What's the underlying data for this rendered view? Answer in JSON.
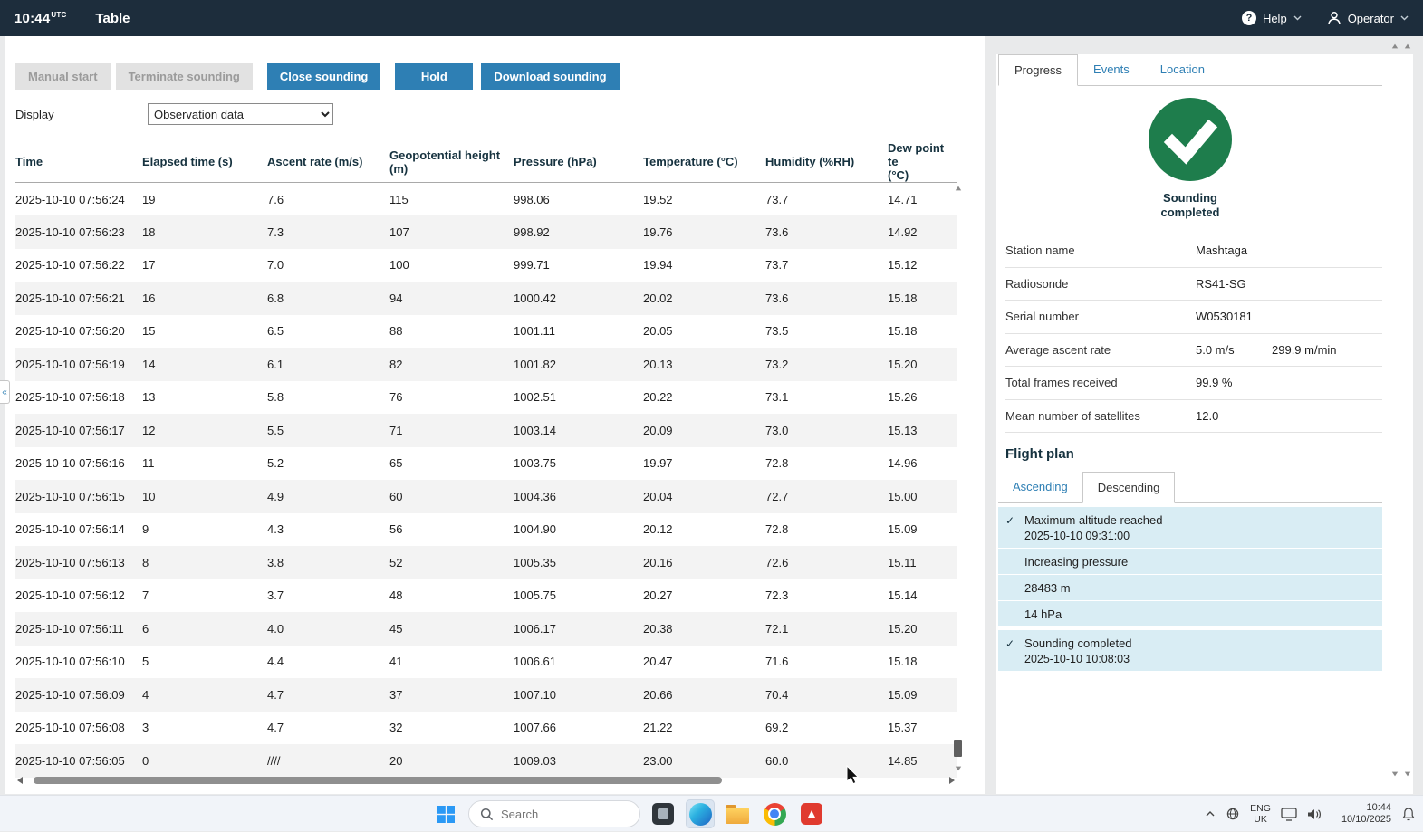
{
  "colors": {
    "topbar_bg": "#1d2d3c",
    "accent": "#2e7fb4",
    "success": "#1e7d4c",
    "event_bg": "#d9edf4",
    "stripe": "#f3f3f3",
    "disabled_bg": "#e2e2e2",
    "disabled_text": "#9b9b9b",
    "navy_text": "#16323f",
    "page_bg": "#e9eaeb",
    "taskbar_bg": "#f1f4f9"
  },
  "topbar": {
    "time": "10:44",
    "time_suffix": "UTC",
    "title": "Table",
    "help_label": "Help",
    "operator_label": "Operator"
  },
  "toolbar": {
    "buttons": [
      {
        "label": "Manual start",
        "state": "disabled"
      },
      {
        "label": "Terminate sounding",
        "state": "disabled"
      },
      {
        "label": "Close sounding",
        "state": "primary"
      },
      {
        "label": "Hold",
        "state": "primary"
      },
      {
        "label": "Download sounding",
        "state": "primary"
      }
    ],
    "display_label": "Display",
    "display_value": "Observation data"
  },
  "table": {
    "columns": [
      "Time",
      "Elapsed time (s)",
      "Ascent rate (m/s)",
      "Geopotential height\n(m)",
      "Pressure (hPa)",
      "Temperature (°C)",
      "Humidity (%RH)",
      "Dew point te\n(°C)"
    ],
    "rows": [
      [
        "2025-10-10 07:56:24",
        "19",
        "7.6",
        "115",
        "998.06",
        "19.52",
        "73.7",
        "14.71"
      ],
      [
        "2025-10-10 07:56:23",
        "18",
        "7.3",
        "107",
        "998.92",
        "19.76",
        "73.6",
        "14.92"
      ],
      [
        "2025-10-10 07:56:22",
        "17",
        "7.0",
        "100",
        "999.71",
        "19.94",
        "73.7",
        "15.12"
      ],
      [
        "2025-10-10 07:56:21",
        "16",
        "6.8",
        "94",
        "1000.42",
        "20.02",
        "73.6",
        "15.18"
      ],
      [
        "2025-10-10 07:56:20",
        "15",
        "6.5",
        "88",
        "1001.11",
        "20.05",
        "73.5",
        "15.18"
      ],
      [
        "2025-10-10 07:56:19",
        "14",
        "6.1",
        "82",
        "1001.82",
        "20.13",
        "73.2",
        "15.20"
      ],
      [
        "2025-10-10 07:56:18",
        "13",
        "5.8",
        "76",
        "1002.51",
        "20.22",
        "73.1",
        "15.26"
      ],
      [
        "2025-10-10 07:56:17",
        "12",
        "5.5",
        "71",
        "1003.14",
        "20.09",
        "73.0",
        "15.13"
      ],
      [
        "2025-10-10 07:56:16",
        "11",
        "5.2",
        "65",
        "1003.75",
        "19.97",
        "72.8",
        "14.96"
      ],
      [
        "2025-10-10 07:56:15",
        "10",
        "4.9",
        "60",
        "1004.36",
        "20.04",
        "72.7",
        "15.00"
      ],
      [
        "2025-10-10 07:56:14",
        "9",
        "4.3",
        "56",
        "1004.90",
        "20.12",
        "72.8",
        "15.09"
      ],
      [
        "2025-10-10 07:56:13",
        "8",
        "3.8",
        "52",
        "1005.35",
        "20.16",
        "72.6",
        "15.11"
      ],
      [
        "2025-10-10 07:56:12",
        "7",
        "3.7",
        "48",
        "1005.75",
        "20.27",
        "72.3",
        "15.14"
      ],
      [
        "2025-10-10 07:56:11",
        "6",
        "4.0",
        "45",
        "1006.17",
        "20.38",
        "72.1",
        "15.20"
      ],
      [
        "2025-10-10 07:56:10",
        "5",
        "4.4",
        "41",
        "1006.61",
        "20.47",
        "71.6",
        "15.18"
      ],
      [
        "2025-10-10 07:56:09",
        "4",
        "4.7",
        "37",
        "1007.10",
        "20.66",
        "70.4",
        "15.09"
      ],
      [
        "2025-10-10 07:56:08",
        "3",
        "4.7",
        "32",
        "1007.66",
        "21.22",
        "69.2",
        "15.37"
      ],
      [
        "2025-10-10 07:56:05",
        "0",
        "////",
        "20",
        "1009.03",
        "23.00",
        "60.0",
        "14.85"
      ]
    ]
  },
  "right_panel": {
    "tabs": [
      "Progress",
      "Events",
      "Location"
    ],
    "active_tab": "Progress",
    "status_line1": "Sounding",
    "status_line2": "completed",
    "info": [
      {
        "label": "Station name",
        "value": "Mashtaga"
      },
      {
        "label": "Radiosonde",
        "value": "RS41-SG"
      },
      {
        "label": "Serial number",
        "value": "W0530181"
      },
      {
        "label": "Average ascent rate",
        "value": "5.0 m/s",
        "value2": "299.9 m/min"
      },
      {
        "label": "Total frames received",
        "value": "99.9 %"
      },
      {
        "label": "Mean number of satellites",
        "value": "12.0"
      }
    ],
    "flight_plan": {
      "title": "Flight plan",
      "tabs": [
        "Ascending",
        "Descending"
      ],
      "active_tab": "Descending",
      "events": [
        {
          "checked": true,
          "lines": [
            "Maximum altitude reached",
            "2025-10-10 09:31:00"
          ]
        },
        {
          "checked": false,
          "lines": [
            "Increasing pressure"
          ]
        },
        {
          "checked": false,
          "lines": [
            "28483 m"
          ]
        },
        {
          "checked": false,
          "lines": [
            "14 hPa"
          ]
        },
        {
          "checked": true,
          "lines": [
            "Sounding completed",
            "2025-10-10 10:08:03"
          ]
        }
      ]
    }
  },
  "taskbar": {
    "search_placeholder": "Search",
    "lang_line1": "ENG",
    "lang_line2": "UK",
    "time": "10:44",
    "date": "10/10/2025"
  }
}
